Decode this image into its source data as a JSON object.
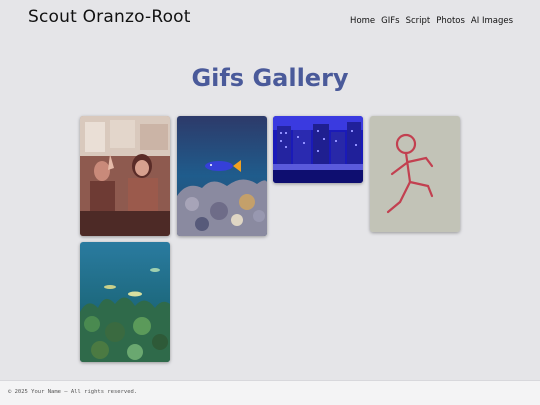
{
  "site": {
    "title": "Scout Oranzo-Root"
  },
  "nav": {
    "items": [
      {
        "label": "Home"
      },
      {
        "label": "GIFs"
      },
      {
        "label": "Script"
      },
      {
        "label": "Photos"
      },
      {
        "label": "AI Images"
      }
    ]
  },
  "main": {
    "heading": "Gifs Gallery"
  },
  "gallery": {
    "items": [
      {
        "icon": "people-waving-image"
      },
      {
        "icon": "aquarium-fish-image"
      },
      {
        "icon": "night-city-image"
      },
      {
        "icon": "stick-figure-running-image"
      },
      {
        "icon": "coral-reef-image"
      }
    ]
  },
  "footer": {
    "copyright": "© 2025 Your Name — All rights reserved."
  },
  "colors": {
    "background": "#e5e5e8",
    "heading": "#4a5a9a",
    "footer_bg": "#f4f4f5"
  }
}
